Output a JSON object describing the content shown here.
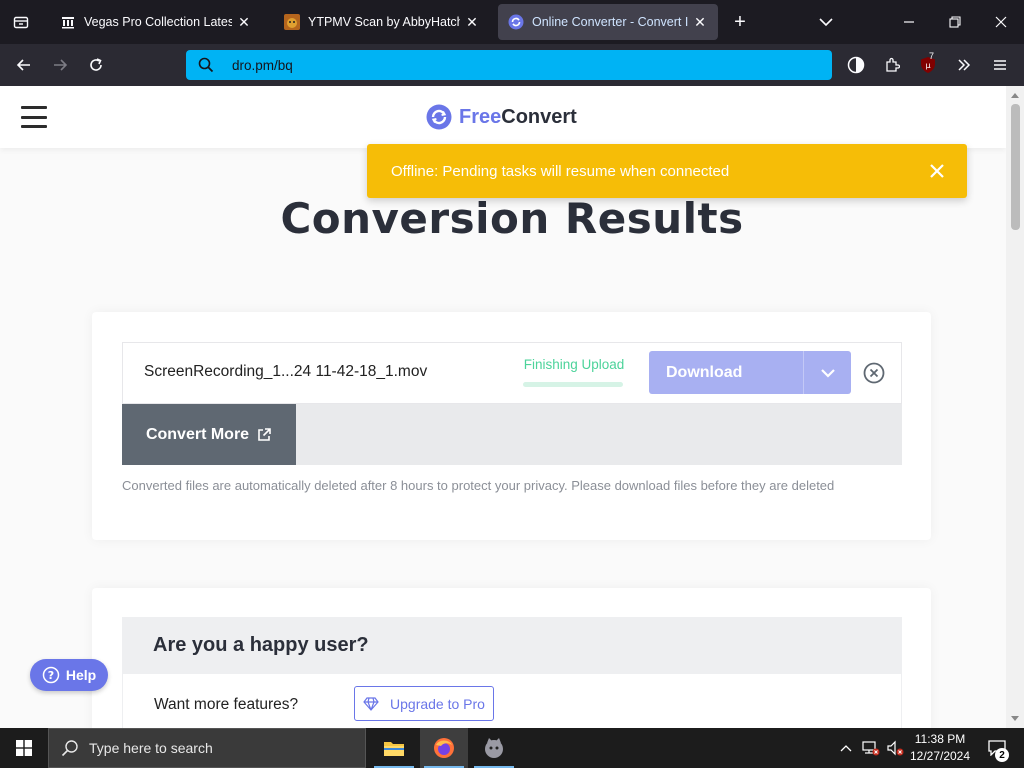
{
  "browser": {
    "tabs": [
      {
        "title": "Vegas Pro Collection Latest Buil",
        "icon": "archive-icon",
        "active": false
      },
      {
        "title": "YTPMV Scan by AbbyHatcheran",
        "icon": "cat-avatar-icon",
        "active": false
      },
      {
        "title": "Online Converter - Convert Ima",
        "icon": "freeconvert-icon",
        "active": true
      }
    ],
    "url": "dro.pm/bq",
    "extension_badge": "7"
  },
  "site": {
    "logo_free": "Free",
    "logo_convert": "Convert",
    "accent_color": "#6a76e8"
  },
  "toast": {
    "message": "Offline: Pending tasks will resume when connected",
    "color": "#f6bd07"
  },
  "results": {
    "heading": "Conversion Results",
    "file": {
      "name": "ScreenRecording_1...24 11-42-18_1.mov",
      "status": "Finishing Upload",
      "download_label": "Download"
    },
    "convert_more_label": "Convert More",
    "note": "Converted files are automatically deleted after 8 hours to protect your privacy. Please download files before they are deleted"
  },
  "happy": {
    "heading": "Are you a happy user?",
    "prompt": "Want more features?",
    "upgrade_label": "Upgrade to Pro"
  },
  "help_label": "Help",
  "taskbar": {
    "search_placeholder": "Type here to search",
    "time": "11:38 PM",
    "date": "12/27/2024",
    "notification_count": "2"
  }
}
